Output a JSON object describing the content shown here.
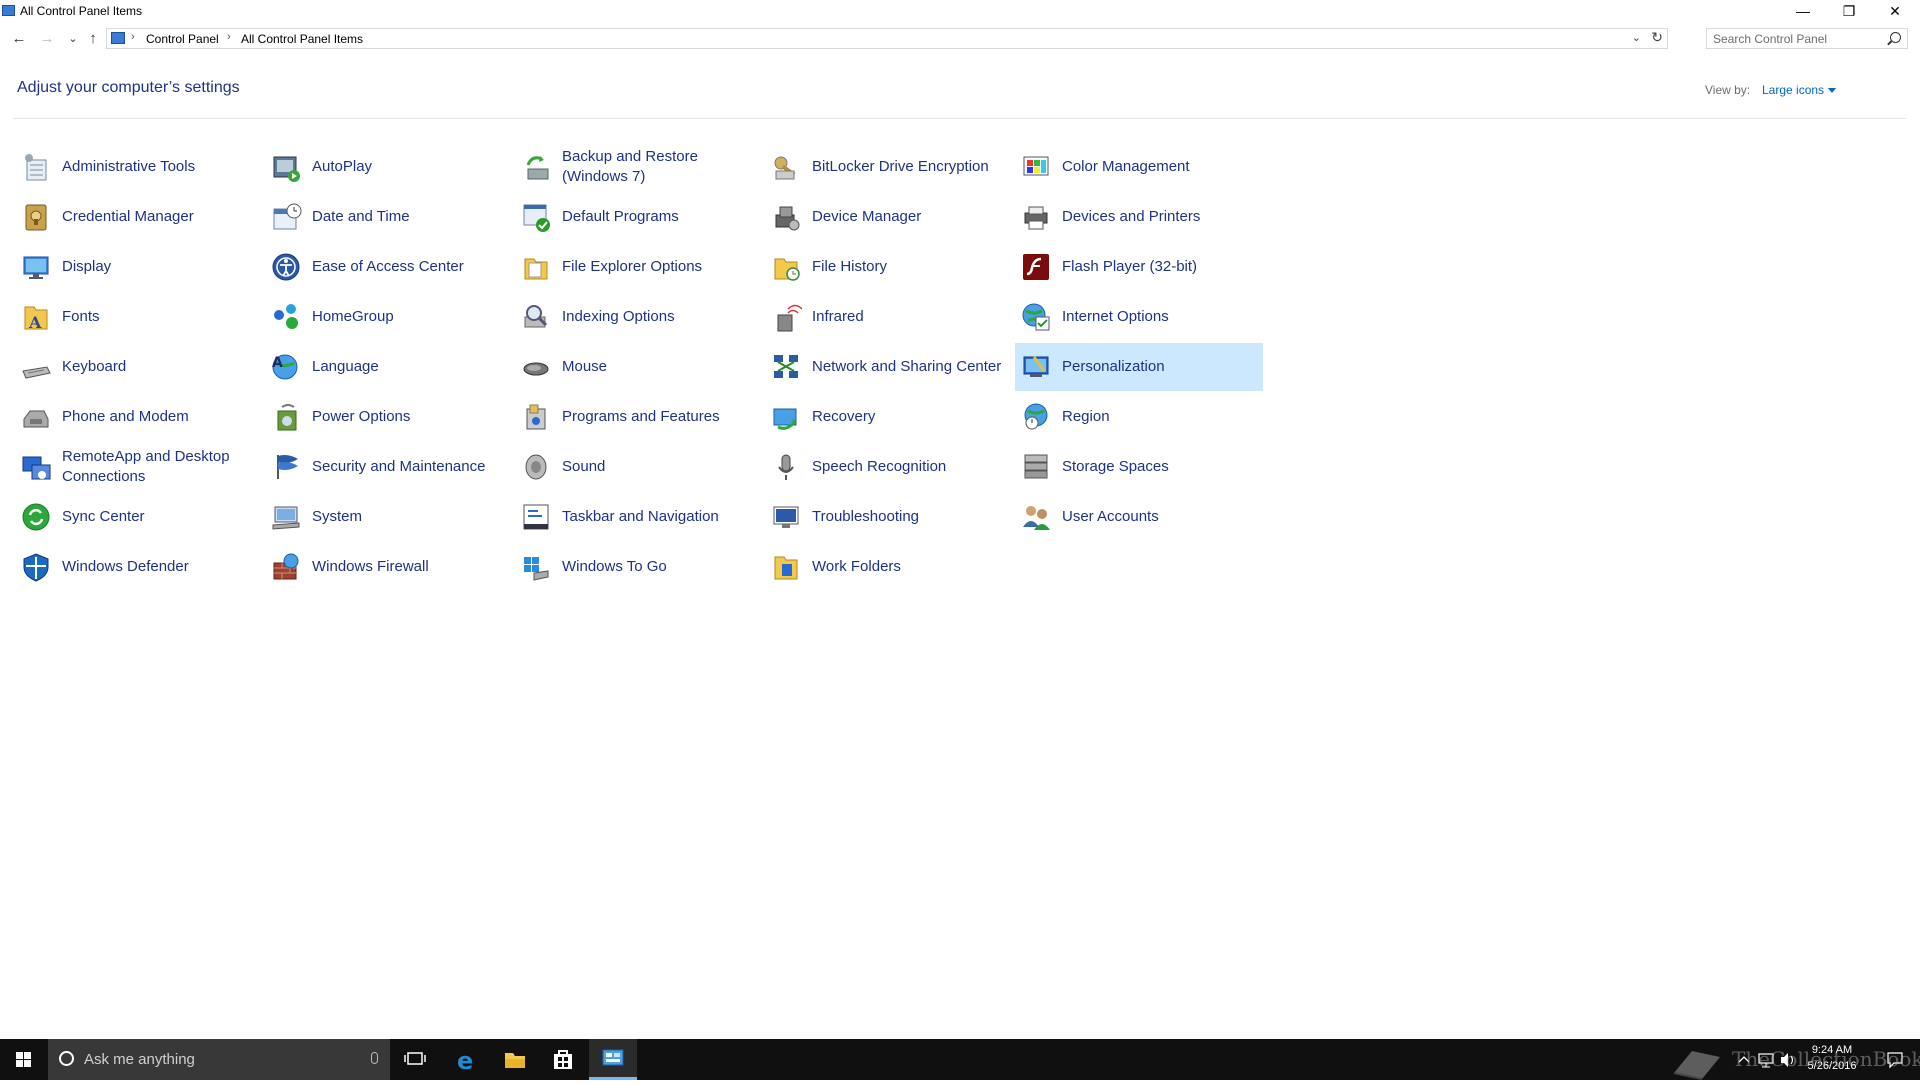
{
  "window": {
    "title": "All Control Panel Items",
    "minimize_glyph": "—",
    "restore_glyph": "❐",
    "close_glyph": "✕"
  },
  "nav": {
    "back_glyph": "←",
    "forward_glyph": "→",
    "recent_glyph": "⌄",
    "up_glyph": "↑",
    "breadcrumb": [
      "Control Panel",
      "All Control Panel Items"
    ],
    "separator": "›",
    "dropdown_glyph": "⌄",
    "refresh_glyph": "↻"
  },
  "search": {
    "placeholder": "Search Control Panel",
    "value": ""
  },
  "header": {
    "title": "Adjust your computer’s settings",
    "view_by_label": "View by:",
    "view_by_value": "Large icons"
  },
  "colors": {
    "link": "#1e3287",
    "selected_bg": "#cce8ff",
    "taskbar": "#101010",
    "accent": "#0078d7"
  },
  "items": [
    {
      "label": "Administrative Tools",
      "icon": "admin-tools-icon"
    },
    {
      "label": "AutoPlay",
      "icon": "autoplay-icon"
    },
    {
      "label": "Backup and Restore (Windows 7)",
      "icon": "backup-restore-icon"
    },
    {
      "label": "BitLocker Drive Encryption",
      "icon": "bitlocker-icon"
    },
    {
      "label": "Color Management",
      "icon": "color-management-icon"
    },
    {
      "label": "Credential Manager",
      "icon": "credential-manager-icon"
    },
    {
      "label": "Date and Time",
      "icon": "date-time-icon"
    },
    {
      "label": "Default Programs",
      "icon": "default-programs-icon"
    },
    {
      "label": "Device Manager",
      "icon": "device-manager-icon"
    },
    {
      "label": "Devices and Printers",
      "icon": "devices-printers-icon"
    },
    {
      "label": "Display",
      "icon": "display-icon"
    },
    {
      "label": "Ease of Access Center",
      "icon": "ease-of-access-icon"
    },
    {
      "label": "File Explorer Options",
      "icon": "file-explorer-options-icon"
    },
    {
      "label": "File History",
      "icon": "file-history-icon"
    },
    {
      "label": "Flash Player (32-bit)",
      "icon": "flash-player-icon"
    },
    {
      "label": "Fonts",
      "icon": "fonts-icon"
    },
    {
      "label": "HomeGroup",
      "icon": "homegroup-icon"
    },
    {
      "label": "Indexing Options",
      "icon": "indexing-options-icon"
    },
    {
      "label": "Infrared",
      "icon": "infrared-icon"
    },
    {
      "label": "Internet Options",
      "icon": "internet-options-icon"
    },
    {
      "label": "Keyboard",
      "icon": "keyboard-icon"
    },
    {
      "label": "Language",
      "icon": "language-icon"
    },
    {
      "label": "Mouse",
      "icon": "mouse-icon"
    },
    {
      "label": "Network and Sharing Center",
      "icon": "network-sharing-icon"
    },
    {
      "label": "Personalization",
      "icon": "personalization-icon",
      "selected": true
    },
    {
      "label": "Phone and Modem",
      "icon": "phone-modem-icon"
    },
    {
      "label": "Power Options",
      "icon": "power-options-icon"
    },
    {
      "label": "Programs and Features",
      "icon": "programs-features-icon"
    },
    {
      "label": "Recovery",
      "icon": "recovery-icon"
    },
    {
      "label": "Region",
      "icon": "region-icon"
    },
    {
      "label": "RemoteApp and Desktop Connections",
      "icon": "remoteapp-icon"
    },
    {
      "label": "Security and Maintenance",
      "icon": "security-maintenance-icon"
    },
    {
      "label": "Sound",
      "icon": "sound-icon"
    },
    {
      "label": "Speech Recognition",
      "icon": "speech-recognition-icon"
    },
    {
      "label": "Storage Spaces",
      "icon": "storage-spaces-icon"
    },
    {
      "label": "Sync Center",
      "icon": "sync-center-icon"
    },
    {
      "label": "System",
      "icon": "system-icon"
    },
    {
      "label": "Taskbar and Navigation",
      "icon": "taskbar-navigation-icon"
    },
    {
      "label": "Troubleshooting",
      "icon": "troubleshooting-icon"
    },
    {
      "label": "User Accounts",
      "icon": "user-accounts-icon"
    },
    {
      "label": "Windows Defender",
      "icon": "windows-defender-icon"
    },
    {
      "label": "Windows Firewall",
      "icon": "windows-firewall-icon"
    },
    {
      "label": "Windows To Go",
      "icon": "windows-to-go-icon"
    },
    {
      "label": "Work Folders",
      "icon": "work-folders-icon"
    }
  ],
  "taskbar": {
    "search_placeholder": "Ask me anything",
    "apps": [
      "task-view-icon",
      "edge-icon",
      "file-explorer-icon",
      "store-icon",
      "control-panel-icon"
    ],
    "clock_time": "9:24 AM",
    "clock_date": "5/26/2016",
    "watermark_text": "TheCollectionBook"
  }
}
